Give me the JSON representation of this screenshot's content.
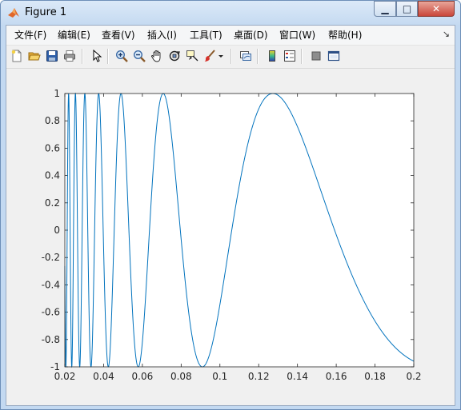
{
  "window": {
    "title": "Figure 1",
    "minimize_glyph": "▁",
    "maximize_glyph": "□",
    "close_glyph": "✕"
  },
  "menu": {
    "items": [
      "文件(F)",
      "编辑(E)",
      "查看(V)",
      "插入(I)",
      "工具(T)",
      "桌面(D)",
      "窗口(W)",
      "帮助(H)"
    ],
    "overflow_glyph": "↘"
  },
  "toolbar": {
    "icons": [
      "new-figure-icon",
      "open-file-icon",
      "save-icon",
      "print-icon",
      "pointer-icon",
      "zoom-in-icon",
      "zoom-out-icon",
      "pan-hand-icon",
      "rotate-3d-icon",
      "data-cursor-icon",
      "brush-icon",
      "brush-dropdown-icon",
      "link-plot-icon",
      "colorbar-icon",
      "legend-icon",
      "hide-plot-tools-icon",
      "show-plot-tools-icon"
    ]
  },
  "colors": {
    "line": "#0072bd",
    "axes_background": "#ffffff",
    "figure_background": "#f0f0f0"
  },
  "chart_data": {
    "type": "line",
    "title": "",
    "xlabel": "",
    "ylabel": "",
    "function": "y = sin(1/x)",
    "xlim": [
      0.02,
      0.2
    ],
    "ylim": [
      -1,
      1
    ],
    "grid": false,
    "xticks": [
      0.02,
      0.04,
      0.06,
      0.08,
      0.1,
      0.12,
      0.14,
      0.16,
      0.18,
      0.2
    ],
    "xtick_labels": [
      "0.02",
      "0.04",
      "0.06",
      "0.08",
      "0.1",
      "0.12",
      "0.14",
      "0.16",
      "0.18",
      "0.2"
    ],
    "yticks": [
      -1,
      -0.8,
      -0.6,
      -0.4,
      -0.2,
      0,
      0.2,
      0.4,
      0.6,
      0.8,
      1
    ],
    "ytick_labels": [
      "-1",
      "-0.8",
      "-0.6",
      "-0.4",
      "-0.2",
      "0",
      "0.2",
      "0.4",
      "0.6",
      "0.8",
      "1"
    ],
    "series": [
      {
        "color": "#0072bd"
      }
    ]
  }
}
